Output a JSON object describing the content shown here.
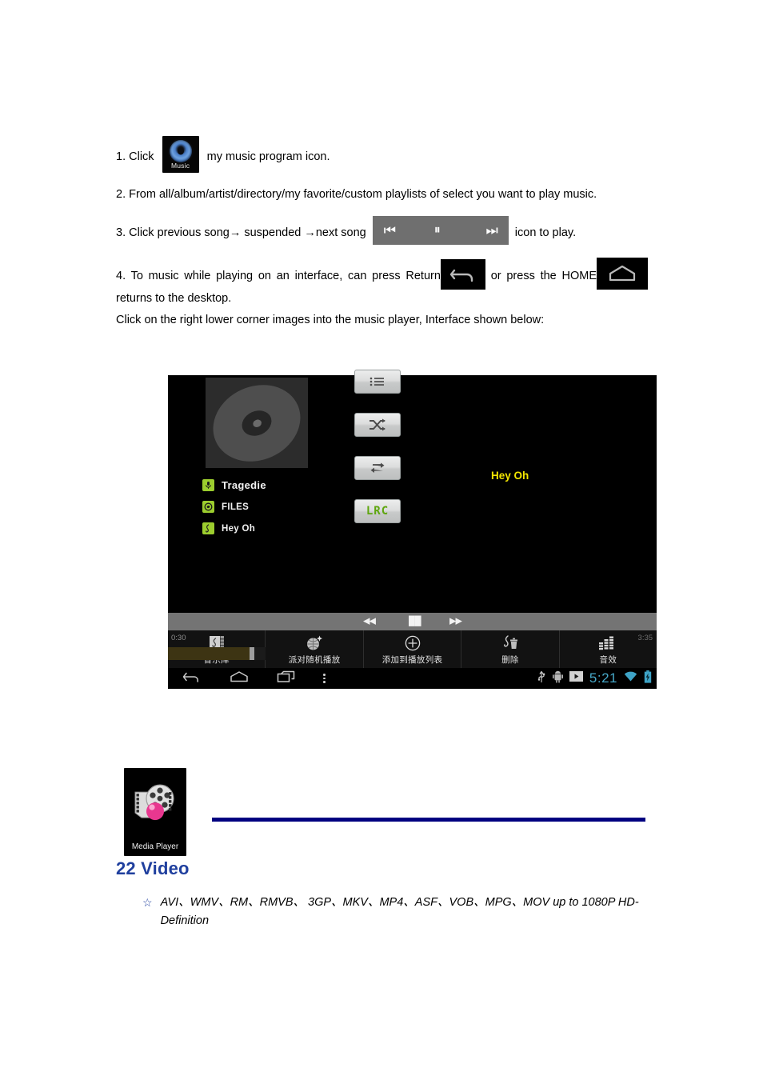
{
  "document": {
    "steps": [
      {
        "id": "step1",
        "prefix": "1. Click",
        "icon_label": "Music",
        "suffix": "my music program icon."
      },
      {
        "id": "step2",
        "text": "2. From all/album/artist/directory/my favorite/custom playlists of select you want to play music."
      },
      {
        "id": "step3",
        "prefix": "3. Click previous song→ suspended →next song",
        "suffix": "icon to play.",
        "prev_glyph": "⏮",
        "pause_glyph": "⏸",
        "next_glyph": "⏭"
      },
      {
        "id": "step4",
        "prefix": "4. To music while playing on an interface, can press Return",
        "middle": "or press the HOME",
        "suffix": "returns to the desktop."
      },
      {
        "id": "step5",
        "text": "Click on the right lower corner images into the music player, Interface shown below:"
      }
    ]
  },
  "player_screenshot": {
    "album_art": "disc-placeholder",
    "track_meta": [
      {
        "icon": "microphone-icon",
        "label": "Tragedie"
      },
      {
        "icon": "disc-icon",
        "label": "FILES"
      },
      {
        "icon": "music-note-icon",
        "label": "Hey Oh"
      }
    ],
    "side_buttons": [
      {
        "icon": "playlist-icon",
        "label": ""
      },
      {
        "icon": "shuffle-icon",
        "label": ""
      },
      {
        "icon": "repeat-icon",
        "label": ""
      },
      {
        "icon": "lrc-icon",
        "label": "LRC"
      }
    ],
    "lyrics": "Hey Oh",
    "transport": {
      "previous": "◀◀",
      "pause": "██",
      "next": "▶▶"
    },
    "progress": {
      "elapsed": "0:30",
      "duration": "3:35",
      "percent": 84
    },
    "actions": [
      {
        "icon": "music-library-icon",
        "label": "音乐库"
      },
      {
        "icon": "party-shuffle-icon",
        "label": "派对随机播放"
      },
      {
        "icon": "add-to-playlist-icon",
        "label": "添加到播放列表"
      },
      {
        "icon": "delete-icon",
        "label": "删除"
      },
      {
        "icon": "sound-effects-icon",
        "label": "音效"
      }
    ],
    "system_bar": {
      "nav": [
        "back-icon",
        "home-icon",
        "recents-icon",
        "overflow-menu-icon"
      ],
      "status_icons": [
        "usb-icon",
        "android-debug-icon",
        "play-icon"
      ],
      "clock": "5:21",
      "wifi": "wifi-icon",
      "battery": "battery-charging-icon",
      "clock_color": "#47a8c8"
    }
  },
  "media_player": {
    "icon_label": "Media Player",
    "rule_color": "#000080"
  },
  "video_section": {
    "heading": "22 Video",
    "heading_color": "#1f3f9e",
    "bullet_glyph": "☆",
    "bullet_text": "AVI、WMV、RM、RMVB、 3GP、MKV、MP4、ASF、VOB、MPG、MOV up to 1080P HD-Definition"
  }
}
